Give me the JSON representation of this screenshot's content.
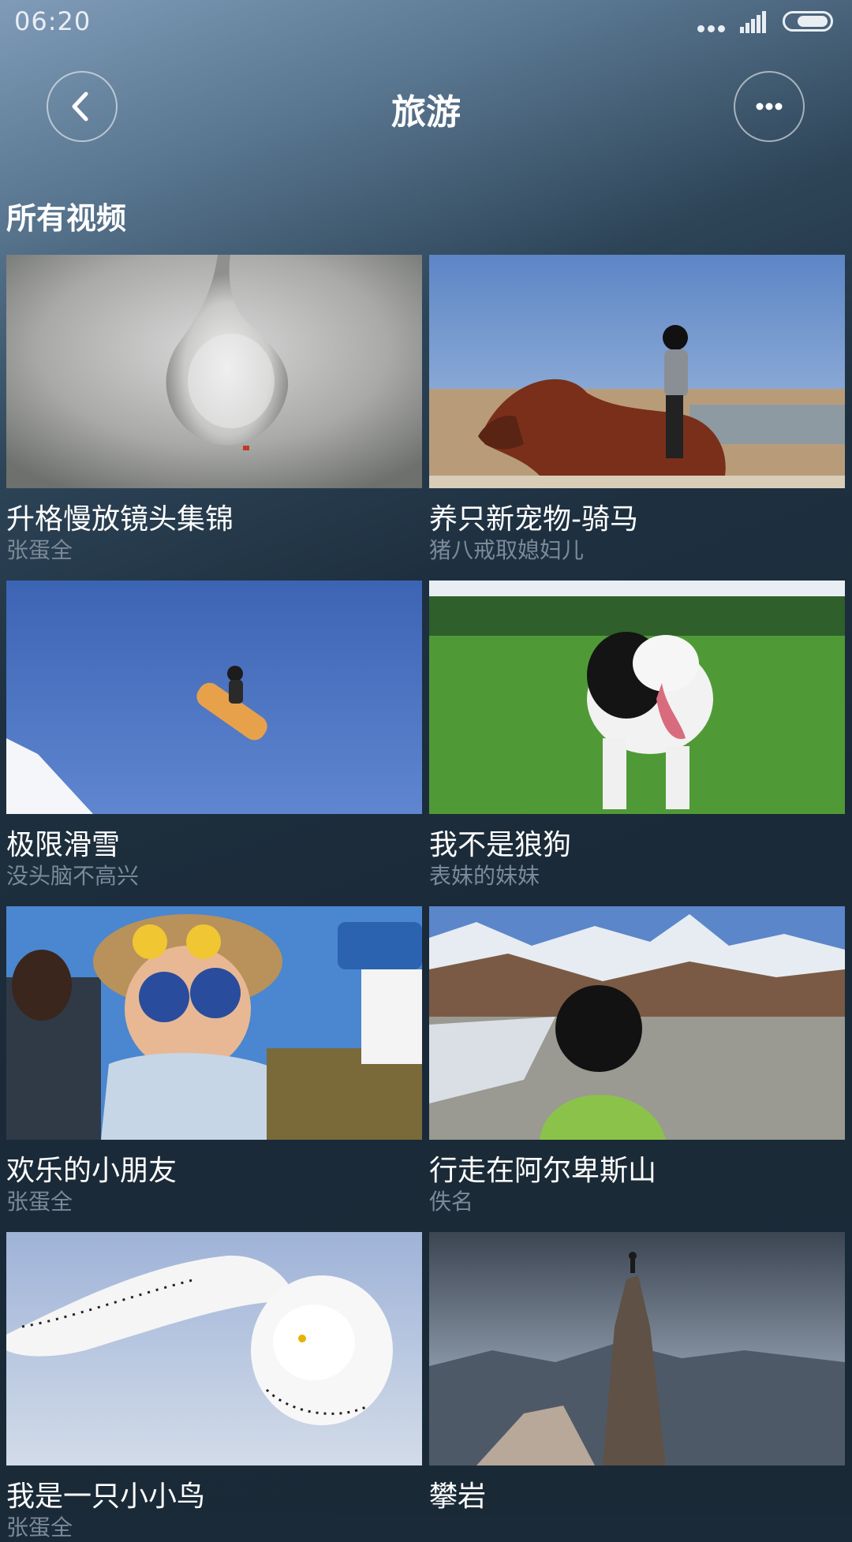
{
  "status_bar": {
    "time": "06:20"
  },
  "header": {
    "title": "旅游",
    "back_icon": "chevron-left-icon",
    "more_icon": "more-horizontal-icon"
  },
  "section": {
    "title": "所有视频"
  },
  "videos": [
    {
      "title": "升格慢放镜头集锦",
      "author": "张蛋全"
    },
    {
      "title": "养只新宠物-骑马",
      "author": "猪八戒取媳妇儿"
    },
    {
      "title": "极限滑雪",
      "author": "没头脑不高兴"
    },
    {
      "title": "我不是狼狗",
      "author": "表妹的妹妹"
    },
    {
      "title": "欢乐的小朋友",
      "author": "张蛋全"
    },
    {
      "title": "行走在阿尔卑斯山",
      "author": "佚名"
    },
    {
      "title": "我是一只小小鸟",
      "author": "张蛋全"
    },
    {
      "title": "攀岩",
      "author": ""
    }
  ]
}
